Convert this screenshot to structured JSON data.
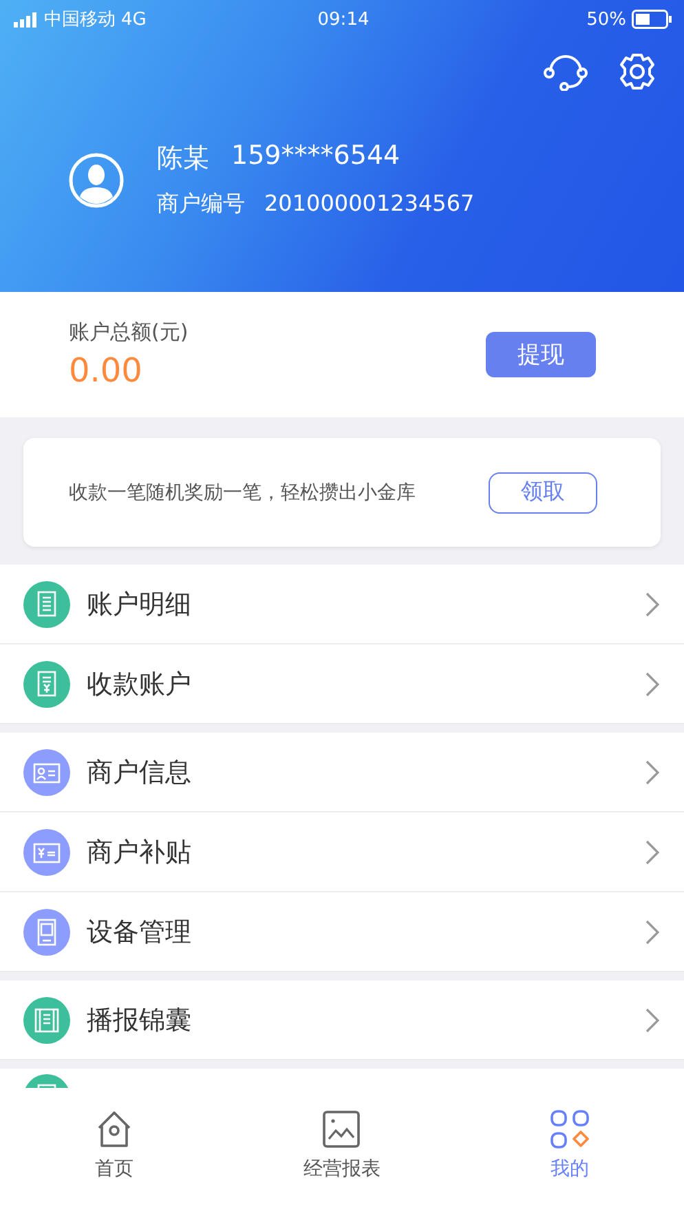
{
  "status_bar": {
    "carrier": "中国移动",
    "network": "4G",
    "time": "09:14",
    "battery": "50%"
  },
  "profile": {
    "name": "陈某",
    "phone": "159****6544",
    "merchant_label": "商户编号",
    "merchant_no": "201000001234567"
  },
  "balance": {
    "label": "账户总额(元)",
    "amount": "0.00",
    "button": "提现"
  },
  "promo": {
    "text": "收款一笔随机奖励一笔，轻松攒出小金库",
    "button": "领取"
  },
  "menu_groups": [
    [
      {
        "label": "账户明细",
        "kind": "list",
        "color": "#3dbf9c"
      },
      {
        "label": "收款账户",
        "kind": "receipt",
        "color": "#3dbf9c"
      }
    ],
    [
      {
        "label": "商户信息",
        "kind": "id-card",
        "color": "#8c9cff"
      },
      {
        "label": "商户补贴",
        "kind": "subsidy",
        "color": "#8c9cff"
      },
      {
        "label": "设备管理",
        "kind": "device",
        "color": "#8c9cff"
      }
    ],
    [
      {
        "label": "播报锦囊",
        "kind": "scroll",
        "color": "#3dbf9c"
      }
    ],
    [
      {
        "kind": "partial",
        "color": "#3dbf9c"
      }
    ]
  ],
  "tabs": [
    {
      "label": "首页",
      "kind": "home",
      "selected": false
    },
    {
      "label": "经营报表",
      "kind": "report",
      "selected": false
    },
    {
      "label": "我的",
      "kind": "mine",
      "selected": true
    }
  ]
}
